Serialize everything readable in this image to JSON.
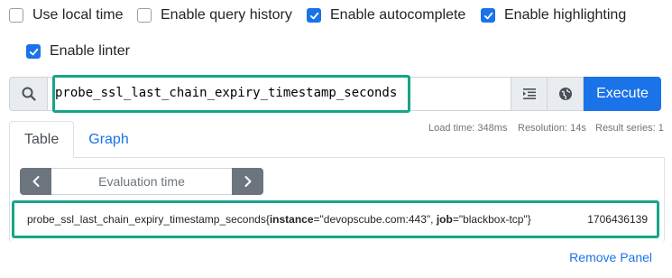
{
  "options": [
    {
      "label": "Use local time",
      "checked": false
    },
    {
      "label": "Enable query history",
      "checked": false
    },
    {
      "label": "Enable autocomplete",
      "checked": true
    },
    {
      "label": "Enable highlighting",
      "checked": true
    },
    {
      "label": "Enable linter",
      "checked": true
    }
  ],
  "query": {
    "expression": "probe_ssl_last_chain_expiry_timestamp_seconds",
    "execute_label": "Execute",
    "icons": {
      "search": "search-icon",
      "format": "format-expression-icon",
      "metrics": "metrics-explorer-icon"
    }
  },
  "stats": {
    "load_time": "Load time: 348ms",
    "resolution": "Resolution: 14s",
    "result_series": "Result series: 1"
  },
  "tabs": [
    {
      "label": "Table",
      "active": true
    },
    {
      "label": "Graph",
      "active": false
    }
  ],
  "evaluation": {
    "label": "Evaluation time",
    "prev_icon": "chevron-left-icon",
    "next_icon": "chevron-right-icon"
  },
  "result": {
    "metric": "probe_ssl_last_chain_expiry_timestamp_seconds",
    "open_brace": "{",
    "label1_key": "instance",
    "label1_value": "=\"devopscube.com:443\"",
    "sep": ", ",
    "label2_key": "job",
    "label2_value": "=\"blackbox-tcp\"",
    "close_brace": "}",
    "value": "1706436139"
  },
  "remove_panel_label": "Remove Panel",
  "colors": {
    "accent": "#1a73e8",
    "highlight_border": "#17a589",
    "nav_button": "#6c757d"
  }
}
